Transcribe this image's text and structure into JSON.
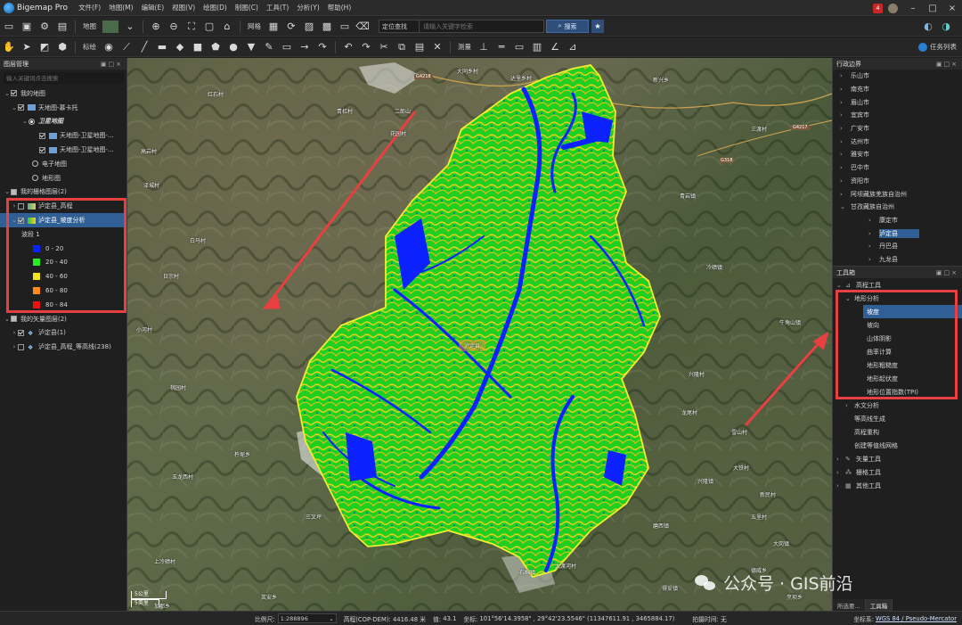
{
  "app": {
    "name": "Bigemap Pro"
  },
  "menu": [
    "文件(F)",
    "地图(M)",
    "编辑(E)",
    "视图(V)",
    "绘图(D)",
    "制图(C)",
    "工具(T)",
    "分析(Y)",
    "帮助(H)"
  ],
  "titlebar": {
    "notification_count": "4"
  },
  "toolbar1": {
    "map_label": "地图",
    "grid_label": "网格",
    "search_select": "定位查找",
    "search_placeholder": "请输入关键字检索",
    "search_button": "搜索"
  },
  "toolbar2": {
    "annotate_label": "标绘",
    "measure_label": "测量",
    "task_button": "任务列表"
  },
  "layers_panel": {
    "title": "图层管理",
    "filter_placeholder": "输入关键词点击搜索",
    "my_map": "我的地图",
    "tianditu_group": "天地图-慕卡托",
    "satellite_map": "卫星地图",
    "sat_layer1": "天地图-卫星地图-...",
    "sat_layer2": "天地图-卫星地图-...",
    "electronic_map": "电子地图",
    "terrain_map": "地形图",
    "raster_group": "我的栅格图层(2)",
    "raster1": "泸定县_高程",
    "raster2": "泸定县_坡度分析",
    "band": "波段 1",
    "vector_group": "我的矢量图层(2)",
    "vector1": "泸定县(1)",
    "vector2": "泸定县_高程_等高线(238)"
  },
  "legend": [
    {
      "label": "0 - 20",
      "color": "#0b22ff"
    },
    {
      "label": "20 - 40",
      "color": "#22ee22"
    },
    {
      "label": "40 - 60",
      "color": "#f2e21a"
    },
    {
      "label": "60 - 80",
      "color": "#ff8a1a"
    },
    {
      "label": "80 - 84",
      "color": "#ee1111"
    }
  ],
  "map": {
    "places": [
      "大同乡村",
      "达里乡村",
      "红石村",
      "青杠村",
      "花园村",
      "高岩村",
      "泽城村",
      "三渡村",
      "白马村",
      "日宗村",
      "牛角山镇",
      "青岩镇",
      "大铁村",
      "龙尾村",
      "雪山村",
      "桃园村",
      "三叉坪",
      "五里村",
      "石棉镇",
      "玉龙西村",
      "上冷碛村",
      "大岗镇",
      "新民村",
      "兴隆村",
      "二郎山",
      "小河村",
      "磨西镇",
      "得妥镇",
      "岚安乡",
      "杵坭乡",
      "德威乡",
      "冷碛镇",
      "兴隆镇",
      "烹坝乡",
      "加郡乡",
      "新兴乡",
      "大渡河村"
    ],
    "roads": [
      "G4218",
      "G4217",
      "G318"
    ],
    "popup": "泸定县",
    "scale_km": "5公里",
    "scale_mi": "5英里"
  },
  "admin_panel": {
    "title": "行政边界",
    "items": [
      "乐山市",
      "南充市",
      "眉山市",
      "宜宾市",
      "广安市",
      "达州市",
      "雅安市",
      "巴中市",
      "资阳市",
      "阿坝藏族羌族自治州",
      "甘孜藏族自治州"
    ],
    "children": [
      "康定市",
      "泸定县",
      "丹巴县",
      "九龙县"
    ]
  },
  "tools_panel": {
    "title": "工具箱",
    "elevation_tools": "高程工具",
    "terrain_analysis": "地形分析",
    "terrain_items": [
      "坡度",
      "坡向",
      "山体阴影",
      "曲率计算",
      "地形粗糙度",
      "地形起伏度",
      "地形位置指数(TPI)"
    ],
    "hydro": "水文分析",
    "contour": "等高线生成",
    "resample": "高程重构",
    "contour_grid": "创建等值线网格",
    "vector_tools": "矢量工具",
    "raster_tools": "栅格工具",
    "other_tools": "其他工具",
    "tabs": [
      "所选要...",
      "工具箱"
    ]
  },
  "status": {
    "scale_label": "比例尺:",
    "scale_value": "1:288896",
    "elevation_label": "高程(COP-DEM):",
    "elevation_value": "4416.48 米",
    "value_label": "值:",
    "value": "43.1",
    "coords_label": "坐标:",
    "coords": "101°56'14.3958\" , 29°42'23.5546\"  (11347611.91 , 3465884.17)",
    "capture_label": "拍摄时间:",
    "capture_value": "无",
    "crs_label": "坐标系:",
    "crs_value": "WGS 84 / Pseudo-Mercator"
  },
  "watermark": {
    "text": "公众号 · GIS前沿"
  }
}
